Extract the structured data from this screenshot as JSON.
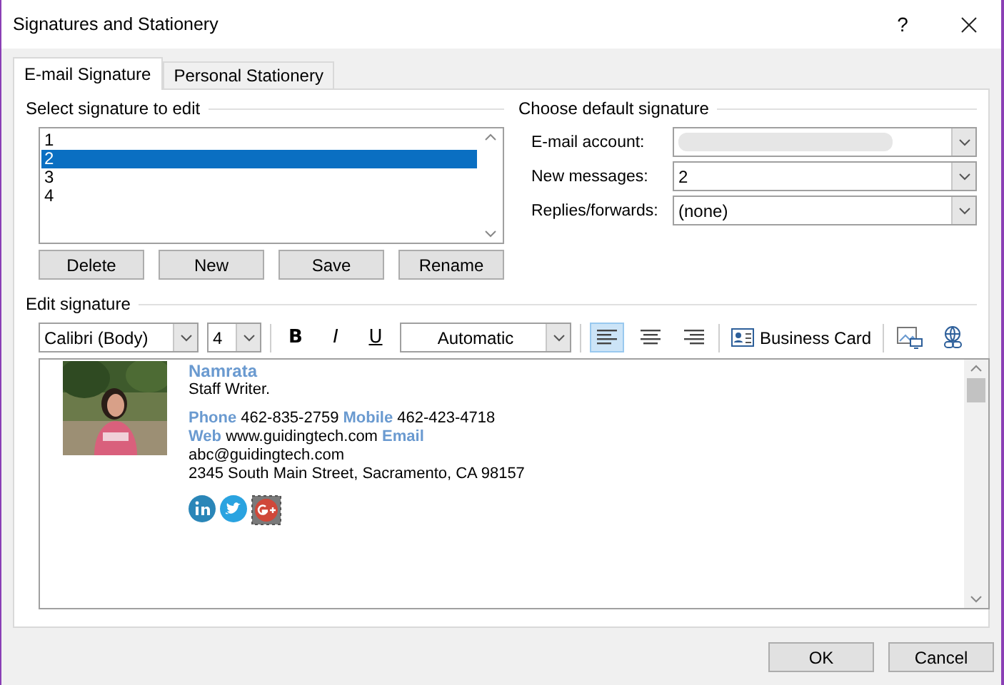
{
  "window": {
    "title": "Signatures and Stationery",
    "help": "?"
  },
  "tabs": [
    {
      "label": "E-mail Signature",
      "selected": true
    },
    {
      "label": "Personal Stationery",
      "selected": false
    }
  ],
  "select_signature": {
    "label": "Select signature to edit",
    "items": [
      {
        "label": "1",
        "selected": false
      },
      {
        "label": "2",
        "selected": true
      },
      {
        "label": "3",
        "selected": false
      },
      {
        "label": "4",
        "selected": false
      }
    ],
    "buttons": [
      "Delete",
      "New",
      "Save",
      "Rename"
    ]
  },
  "default_signature": {
    "label": "Choose default signature",
    "fields": [
      {
        "label": "E-mail account:",
        "kind": "redacted"
      },
      {
        "label": "New messages:",
        "kind": "combo",
        "value": "2"
      },
      {
        "label": "Replies/forwards:",
        "kind": "combo",
        "value": "(none)"
      }
    ]
  },
  "edit_signature": {
    "label": "Edit signature",
    "font": "Calibri (Body)",
    "size": "4",
    "format_buttons": [
      "B",
      "I",
      "U"
    ],
    "font_color": "Automatic",
    "align": [
      {
        "kind": "left",
        "selected": true
      },
      {
        "kind": "center",
        "selected": false
      },
      {
        "kind": "right",
        "selected": false
      }
    ],
    "business_card": "Business Card"
  },
  "signature": {
    "name": "Namrata",
    "role": "Staff Writer.",
    "lines": [
      "**Phone** 462-835-2759  **Mobile** 462-423-4718",
      "**Web** www.guidingtech.com  **Email**",
      "abc@guidingtech.com",
      "2345 South Main Street, Sacramento, CA 98157"
    ],
    "social": [
      {
        "kind": "linkedin"
      },
      {
        "kind": "bird"
      },
      {
        "kind": "gplus"
      }
    ]
  },
  "footer_buttons": [
    "OK",
    "Cancel"
  ]
}
